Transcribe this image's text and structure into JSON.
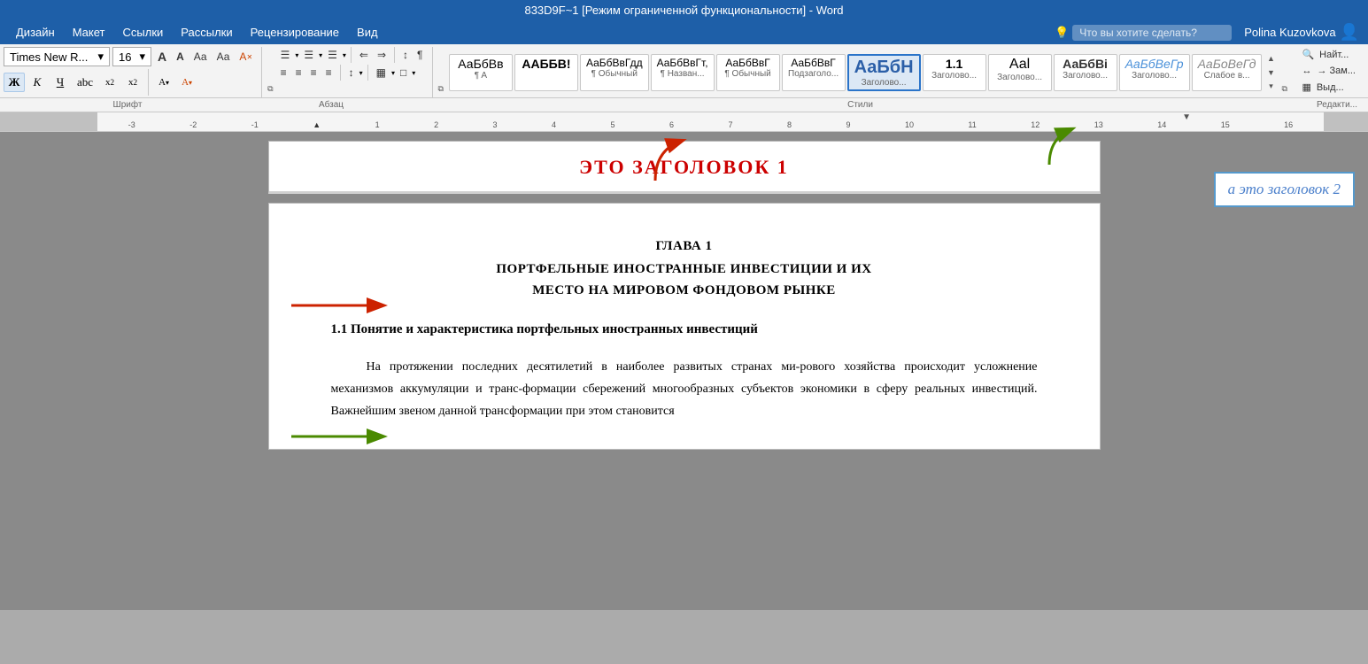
{
  "titleBar": {
    "text": "833D9F~1 [Режим ограниченной функциональности] - Word"
  },
  "menuBar": {
    "items": [
      "Дизайн",
      "Макет",
      "Ссылки",
      "Рассылки",
      "Рецензирование",
      "Вид"
    ],
    "searchPlaceholder": "Что вы хотите сделать?",
    "searchIcon": "🔍",
    "searchLabel": "Что вы хотите сделать?",
    "userLabel": "Polina Kuzovkova"
  },
  "toolbar": {
    "fontName": "Times New R...",
    "fontSize": "16",
    "fontSizeDropIcon": "▾",
    "fontNameDropIcon": "▾",
    "increaseFontLabel": "A",
    "decreaseFontLabel": "A",
    "clearFormatLabel": "A",
    "colorBucketLabel": "A",
    "boldLabel": "Ж",
    "italicLabel": "К",
    "underlineLabel": "Ч",
    "strikeLabel": "abc",
    "subscriptLabel": "x₂",
    "superscriptLabel": "x²",
    "highlightLabel": "A",
    "fontColorLabel": "A",
    "textColorLabel": "A",
    "listBulletLabel": "≡",
    "listNumberLabel": "≡",
    "outdentLabel": "⇐",
    "indentLabel": "⇒",
    "sortLabel": "↕",
    "showMarkLabel": "¶",
    "alignLeftLabel": "≡",
    "alignCenterLabel": "≡",
    "alignRightLabel": "≡",
    "justifyLabel": "≡",
    "lineSpaceLabel": "↕",
    "borderLabel": "□",
    "shadingLabel": "▦"
  },
  "styles": {
    "items": [
      {
        "id": "normal",
        "previewText": "АаБбВв",
        "label": "¶ A"
      },
      {
        "id": "noSpacing",
        "previewText": "ААББВ!",
        "label": ""
      },
      {
        "id": "heading1Normal",
        "previewText": "АаБбВвГдд",
        "label": "¶ Обычный"
      },
      {
        "id": "heading1Name",
        "previewText": "АаБбВвГт,",
        "label": "¶ Назван..."
      },
      {
        "id": "heading1Style",
        "previewText": "АаБбВвГ",
        "label": "¶ Обычный"
      },
      {
        "id": "subheading",
        "previewText": "АаБбВвГ",
        "label": "Подзаголо..."
      },
      {
        "id": "heading1Active",
        "previewText": "АаБбН",
        "label": "Заголово...",
        "active": true
      },
      {
        "id": "heading1_1",
        "previewText": "1.1",
        "label": "Заголово..."
      },
      {
        "id": "heading1_aa",
        "previewText": "Ааl",
        "label": "Заголово..."
      },
      {
        "id": "heading2Style",
        "previewText": "АаБбВi",
        "label": "Заголово..."
      },
      {
        "id": "heading2Blue",
        "previewText": "АаБбВеГр",
        "label": "Заголово...",
        "blue": true
      },
      {
        "id": "weakHeading",
        "previewText": "АаБоВеГд",
        "label": "Слабое в..."
      }
    ]
  },
  "editing": {
    "findLabel": "Найт...",
    "replaceLabel": "→ Зам...",
    "selectLabel": "Выд..."
  },
  "ruler": {
    "marks": [
      "-3",
      "-2",
      "-1",
      "1",
      "2",
      "3",
      "4",
      "5",
      "6",
      "7",
      "8",
      "9",
      "10",
      "11",
      "12",
      "13",
      "14",
      "15",
      "16"
    ]
  },
  "ribbonSections": {
    "font": "Шрифт",
    "paragraph": "Абзац",
    "styles": "Стили"
  },
  "document": {
    "heading1Text": "ЭТО ЗАГОЛОВОК 1",
    "chapterNumber": "ГЛАВА 1",
    "chapterTitle": "ПОРТФЕЛЬНЫЕ ИНОСТРАННЫЕ ИНВЕСТИЦИИ И ИХ\nМЕСТО НА МИРОВОМ ФОНДОВОМ РЫНКЕ",
    "subheadingText": "1.1  Понятие и характеристика портфельных иностранных инвестиций",
    "bodyText": "На протяжении последних десятилетий в наиболее развитых странах мирового хозяйства происходит усложнение механизмов аккумуляции и трансформации сбережений многообразных субъектов экономики в сферу реальных инвестиций. Важнейшим звеном данной трансформации при этом становится"
  },
  "annotations": {
    "heading1Label": "ЭТО ЗАГОЛОВОК 1",
    "heading2Label": "а это заголовок 2",
    "redArrowStyle": "Заголово...",
    "greenArrowStyle": "Заголово..."
  },
  "colors": {
    "ribbonBg": "#1e5fa8",
    "heading1Color": "#cc0000",
    "heading2Color": "#4a7fcb",
    "redArrow": "#cc2200",
    "greenArrow": "#4a8a00",
    "activeStyleBorder": "#2b74c9",
    "activeStyleBg": "#dce8f5"
  }
}
